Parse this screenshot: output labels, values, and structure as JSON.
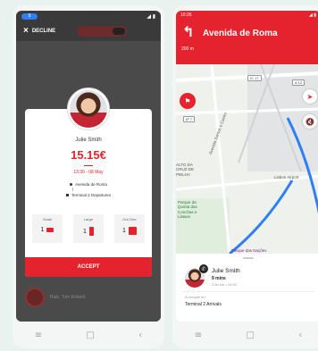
{
  "left": {
    "status": {
      "badge": "9",
      "icons": "◢ ▮"
    },
    "decline_label": "DECLINE",
    "modal": {
      "name": "Julie Smith",
      "price": "15.15€",
      "time": "13:30 - 08 May",
      "pickup": "Avenida de Roma",
      "dropoff": "Terminal 2 Departures",
      "bags": [
        {
          "label": "Small",
          "count": "1"
        },
        {
          "label": "Large",
          "count": "1"
        },
        {
          "label": "Out-Size",
          "count": "1"
        }
      ],
      "accept_label": "ACCEPT"
    },
    "bottom_item": "Raki, Tom Roland",
    "nav": [
      "≡",
      "□",
      "‹"
    ]
  },
  "right": {
    "status": {
      "time": "10:26",
      "icons": "◢ ▮"
    },
    "turn_icon": "↰",
    "street": "Avenida de Roma",
    "distance": "200 m",
    "map": {
      "road_labels": [
        "IC 17",
        "A 12",
        "IP 7"
      ],
      "places": [
        "Lisbon Airport"
      ],
      "green_places": [
        "Parque da Quinta das Conchas e Lilases",
        "Parque das Nações"
      ],
      "street_labels": [
        "Avenida Santos e Castro"
      ],
      "area_labels": [
        "ALTO DA CRUZ DE PIELHA"
      ]
    },
    "sheet": {
      "name": "Julie Smith",
      "mins": "9 mins",
      "sub": "2.80 km • 10:30",
      "dest_label": "A recoger en",
      "dest": "Terminal 2 Arrivals"
    },
    "nav": [
      "≡",
      "□",
      "‹"
    ]
  }
}
